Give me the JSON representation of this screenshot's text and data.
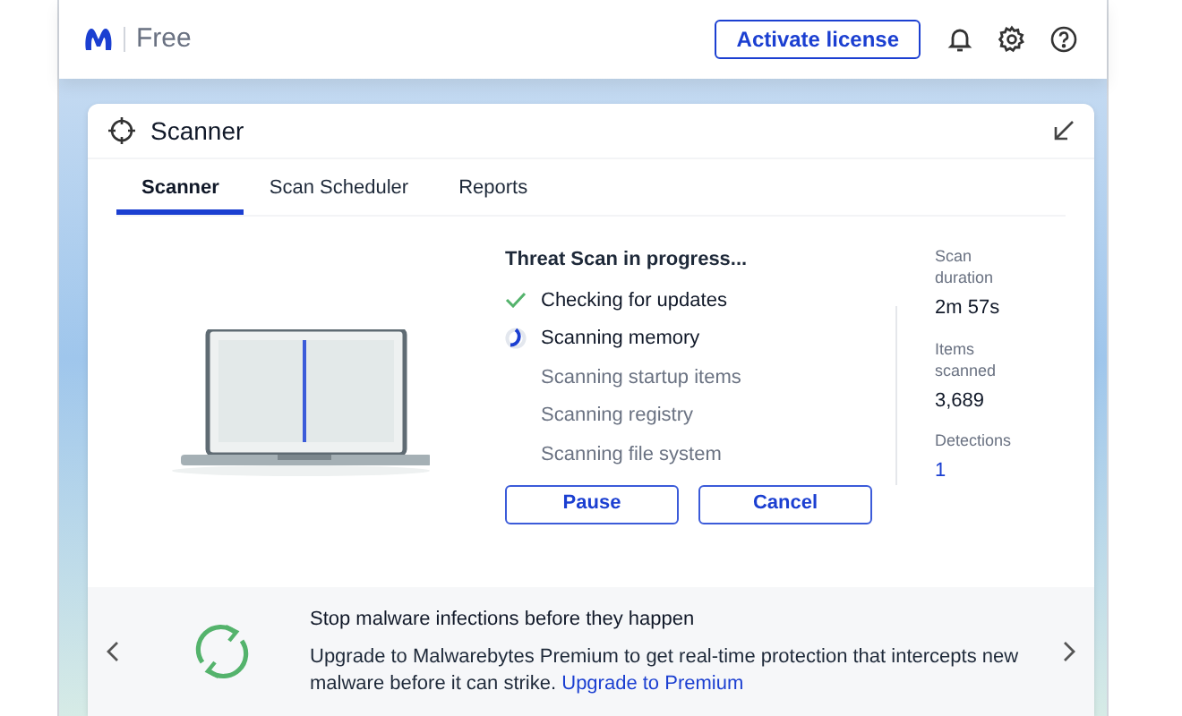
{
  "header": {
    "edition": "Free",
    "activate_button": "Activate license"
  },
  "card": {
    "title": "Scanner",
    "tabs": [
      {
        "label": "Scanner",
        "selected": true
      },
      {
        "label": "Scan Scheduler",
        "selected": false
      },
      {
        "label": "Reports",
        "selected": false
      }
    ],
    "scan": {
      "heading": "Threat Scan in progress...",
      "steps": [
        {
          "label": "Checking for updates",
          "kind": "done"
        },
        {
          "label": "Scanning memory",
          "kind": "active"
        },
        {
          "label": "Scanning startup items",
          "kind": "pending"
        },
        {
          "label": "Scanning registry",
          "kind": "pending"
        },
        {
          "label": "Scanning file system",
          "kind": "pending"
        }
      ],
      "buttons": [
        "Pause",
        "Cancel"
      ],
      "stats": [
        {
          "label": "Scan duration",
          "value": "2m 57s",
          "kind": "plain"
        },
        {
          "label": "Items scanned",
          "value": "3,689",
          "kind": "plain"
        },
        {
          "label": "Detections",
          "value": "1",
          "kind": "link"
        }
      ]
    },
    "promo": {
      "title": "Stop malware infections before they happen",
      "text": "Upgrade to Malwarebytes Premium to get real-time protection that intercepts new malware before it can strike.",
      "link": "Upgrade to Premium"
    }
  }
}
